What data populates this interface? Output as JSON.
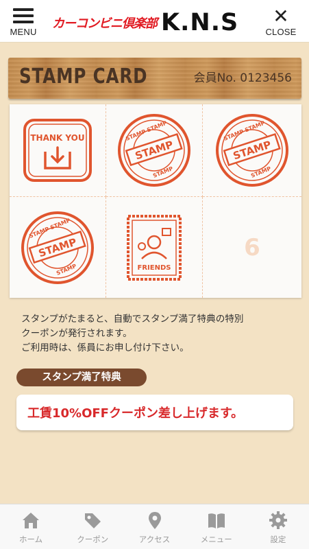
{
  "header": {
    "menu_label": "MENU",
    "close_label": "CLOSE",
    "logo_text": "カーコンビニ倶楽部",
    "store_name": "K.N.S"
  },
  "card": {
    "title": "STAMP CARD",
    "member_no": "会員No. 0123456",
    "stamps": [
      {
        "kind": "thank-you",
        "text": "THANK YOU"
      },
      {
        "kind": "stamp",
        "text": "STAMP"
      },
      {
        "kind": "stamp",
        "text": "STAMP"
      },
      {
        "kind": "stamp",
        "text": "STAMP"
      },
      {
        "kind": "friends",
        "text": "FRIENDS"
      },
      {
        "kind": "empty",
        "text": "6"
      }
    ]
  },
  "description": {
    "line1": "スタンプがたまると、自動でスタンプ満了特典の特別",
    "line2": "クーポンが発行されます。",
    "line3": "ご利用時は、係員にお申し付け下さい。"
  },
  "benefit": {
    "label": "スタンプ満了特典",
    "coupon": "工賃10%OFFクーポン差し上げます。"
  },
  "tabs": [
    {
      "label": "ホーム",
      "icon": "home-icon"
    },
    {
      "label": "クーポン",
      "icon": "tag-icon"
    },
    {
      "label": "アクセス",
      "icon": "map-pin-icon"
    },
    {
      "label": "メニュー",
      "icon": "book-icon"
    },
    {
      "label": "設定",
      "icon": "gear-icon"
    }
  ],
  "colors": {
    "accent_red": "#e11a22",
    "stamp_red": "#e0552e",
    "wood_brown": "#c48d50",
    "label_brown": "#7a4a2e",
    "coupon_red": "#d8292b",
    "background": "#f3e2c4"
  }
}
